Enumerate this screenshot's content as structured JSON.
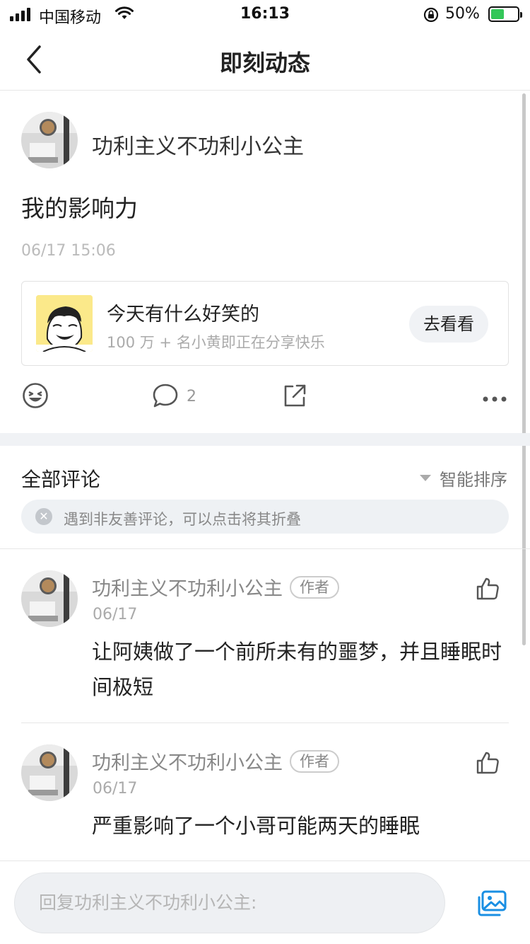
{
  "status_bar": {
    "carrier": "中国移动",
    "time": "16:13",
    "battery": "50%"
  },
  "nav": {
    "title": "即刻动态"
  },
  "post": {
    "user_name": "功利主义不功利小公主",
    "text": "我的影响力",
    "time": "06/17 15:06",
    "card": {
      "title": "今天有什么好笑的",
      "subtitle": "100 万 + 名小黄即正在分享快乐",
      "button": "去看看"
    },
    "actions": {
      "comment_count": "2"
    }
  },
  "comments_section": {
    "title": "全部评论",
    "sort_label": "智能排序",
    "notice": "遇到非友善评论，可以点击将其折叠",
    "comments": [
      {
        "name": "功利主义不功利小公主",
        "badge": "作者",
        "date": "06/17",
        "body": "让阿姨做了一个前所未有的噩梦，并且睡眠时间极短"
      },
      {
        "name": "功利主义不功利小公主",
        "badge": "作者",
        "date": "06/17",
        "body": "严重影响了一个小哥可能两天的睡眠"
      }
    ]
  },
  "reply_bar": {
    "placeholder": "回复功利主义不功利小公主:"
  },
  "colors": {
    "accent_blue": "#1a8fe3",
    "battery_green": "#34c759",
    "band_gray": "#f0f2f5"
  }
}
